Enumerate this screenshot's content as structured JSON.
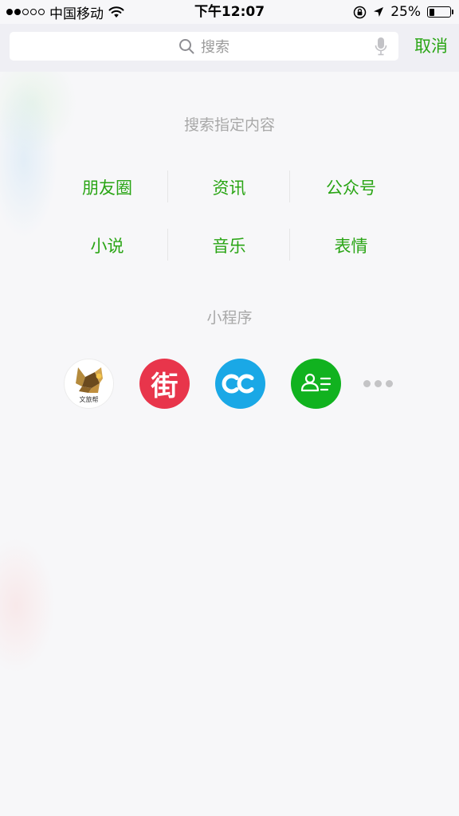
{
  "status_bar": {
    "carrier": "中国移动",
    "time": "下午12:07",
    "battery_percent": "25%",
    "battery_level": 0.25,
    "signal_bars_filled": 2,
    "signal_bars_total": 5
  },
  "search": {
    "placeholder": "搜索",
    "cancel_label": "取消"
  },
  "categories": {
    "title": "搜索指定内容",
    "items": [
      {
        "label": "朋友圈"
      },
      {
        "label": "资讯"
      },
      {
        "label": "公众号"
      },
      {
        "label": "小说"
      },
      {
        "label": "音乐"
      },
      {
        "label": "表情"
      }
    ]
  },
  "mini_programs": {
    "title": "小程序",
    "apps": [
      {
        "icon": "wenlvbang-logo",
        "logo_text": "文旅帮",
        "color": "#ffffff"
      },
      {
        "icon": "jie-logo",
        "glyph": "街",
        "color": "#e8354b"
      },
      {
        "icon": "cc-logo",
        "color": "#1aa8e6"
      },
      {
        "icon": "contact-card-logo",
        "color": "#11b21f"
      }
    ],
    "more_icon": "more-dots-icon"
  },
  "colors": {
    "accent_green": "#2aa515",
    "section_title_gray": "#a8a8a8"
  }
}
